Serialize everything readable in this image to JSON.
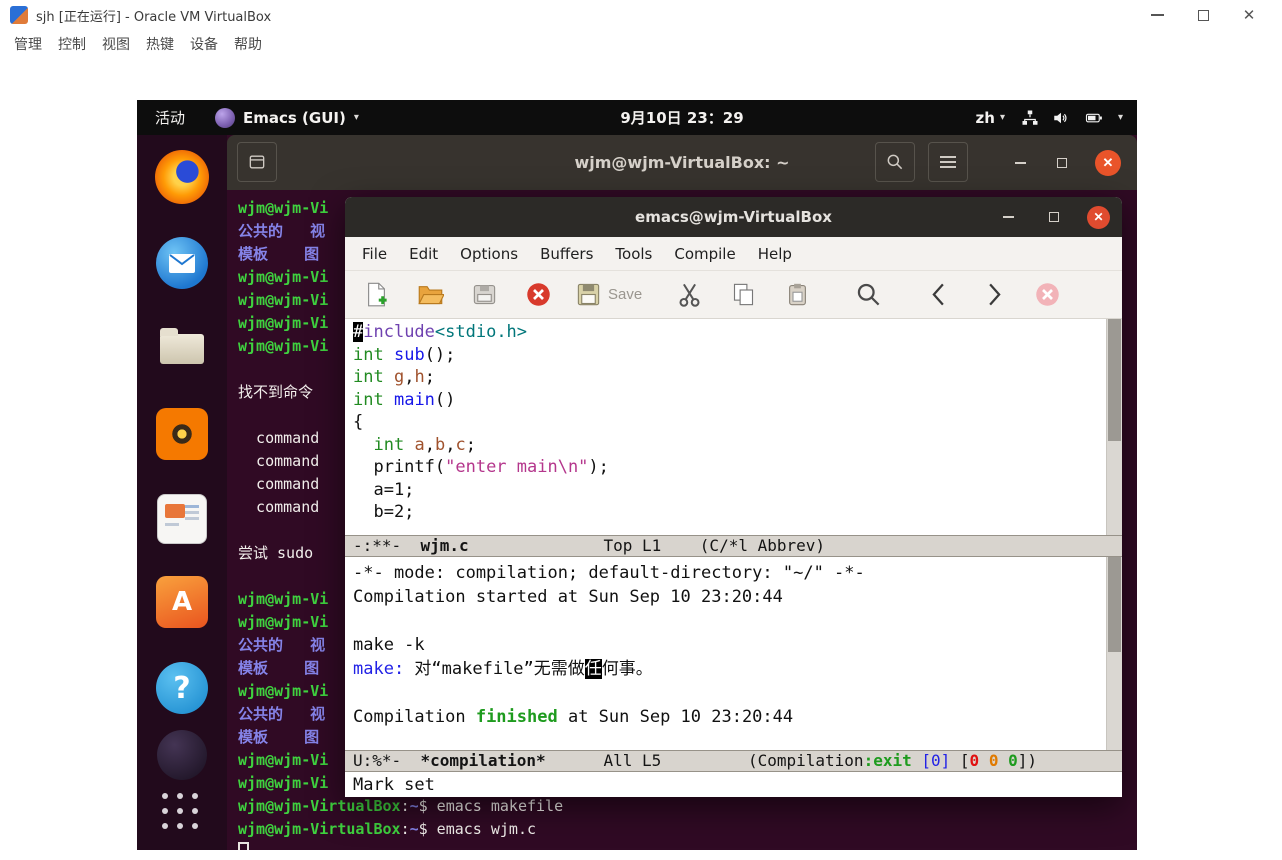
{
  "glyphs": {
    "close_x": "✕",
    "caret_down": "▾",
    "question": "?",
    "software_letter": "A"
  },
  "colors": {
    "desktop_purple": "#2F0A24",
    "terminal_bg": "#300A24",
    "prompt_green": "#3FD23F",
    "directory_blue": "#8583E8",
    "ubuntu_orange": "#E9542A",
    "type_green": "#228B22",
    "function_blue": "#1717E8",
    "variable_sienna": "#A0522D",
    "string_magenta": "#B4368C",
    "success_green": "#1E9B1E",
    "info_blue": "#2222E6"
  },
  "vbox": {
    "title": "sjh [正在运行] - Oracle VM VirtualBox",
    "menu_items": [
      "管理",
      "控制",
      "视图",
      "热键",
      "设备",
      "帮助"
    ]
  },
  "topbar": {
    "activities": "活动",
    "app_name": "Emacs (GUI)",
    "clock": "9月10日 23：29",
    "lang": "zh"
  },
  "dock": {
    "items": [
      "firefox",
      "thunderbird-mail",
      "files",
      "rhythmbox",
      "libreoffice-impress",
      "ubuntu-software",
      "help",
      "background-app",
      "show-applications"
    ]
  },
  "terminal": {
    "title": "wjm@wjm-VirtualBox: ~",
    "lines": [
      [
        {
          "t": "wjm@wjm-Vi",
          "c": "prompt"
        }
      ],
      [
        {
          "t": "公共的   视",
          "c": "dir"
        }
      ],
      [
        {
          "t": "模板    图",
          "c": "dir"
        }
      ],
      [
        {
          "t": "wjm@wjm-Vi",
          "c": "prompt"
        }
      ],
      [
        {
          "t": "wjm@wjm-Vi",
          "c": "prompt"
        }
      ],
      [
        {
          "t": "wjm@wjm-Vi",
          "c": "prompt"
        }
      ],
      [
        {
          "t": "wjm@wjm-Vi",
          "c": "prompt"
        }
      ],
      [],
      [
        {
          "t": "找不到命令"
        }
      ],
      [],
      [
        {
          "t": "  command"
        }
      ],
      [
        {
          "t": "  command"
        }
      ],
      [
        {
          "t": "  command"
        }
      ],
      [
        {
          "t": "  command"
        }
      ],
      [],
      [
        {
          "t": "尝试 sudo"
        }
      ],
      [],
      [
        {
          "t": "wjm@wjm-Vi",
          "c": "prompt"
        }
      ],
      [
        {
          "t": "wjm@wjm-Vi",
          "c": "prompt"
        }
      ],
      [
        {
          "t": "公共的   视",
          "c": "dir"
        }
      ],
      [
        {
          "t": "模板    图",
          "c": "dir"
        }
      ],
      [
        {
          "t": "wjm@wjm-Vi",
          "c": "prompt"
        }
      ],
      [
        {
          "t": "公共的   视",
          "c": "dir"
        }
      ],
      [
        {
          "t": "模板    图",
          "c": "dir"
        }
      ],
      [
        {
          "t": "wjm@wjm-Vi",
          "c": "prompt"
        }
      ],
      [
        {
          "t": "wjm@wjm-Vi",
          "c": "prompt"
        }
      ],
      [
        {
          "t": "wjm@wjm-VirtualBox",
          "c": "prompt"
        },
        {
          "t": ":"
        },
        {
          "t": "~",
          "c": "dir"
        },
        {
          "t": "$ emacs makefile"
        }
      ],
      [
        {
          "t": "wjm@wjm-VirtualBox",
          "c": "prompt"
        },
        {
          "t": ":"
        },
        {
          "t": "~",
          "c": "dir"
        },
        {
          "t": "$ emacs wjm.c"
        }
      ],
      [
        {
          "t": "",
          "c": "hollow"
        }
      ]
    ]
  },
  "emacs": {
    "title": "emacs@wjm-VirtualBox",
    "menu_items": [
      "File",
      "Edit",
      "Options",
      "Buffers",
      "Tools",
      "Compile",
      "Help"
    ],
    "toolbar": {
      "save_label": "Save"
    },
    "code_lines": [
      [
        {
          "t": "#",
          "c": "cursor"
        },
        {
          "t": "include",
          "c": "pp"
        },
        {
          "t": "<stdio.h>",
          "c": "inc"
        }
      ],
      [
        {
          "t": "int",
          "c": "type"
        },
        {
          "t": " "
        },
        {
          "t": "sub",
          "c": "fn"
        },
        {
          "t": "();"
        }
      ],
      [
        {
          "t": "int",
          "c": "type"
        },
        {
          "t": " "
        },
        {
          "t": "g",
          "c": "var"
        },
        {
          "t": ","
        },
        {
          "t": "h",
          "c": "var"
        },
        {
          "t": ";"
        }
      ],
      [
        {
          "t": "int",
          "c": "type"
        },
        {
          "t": " "
        },
        {
          "t": "main",
          "c": "fn"
        },
        {
          "t": "()"
        }
      ],
      [
        {
          "t": "{"
        }
      ],
      [
        {
          "t": "  "
        },
        {
          "t": "int",
          "c": "type"
        },
        {
          "t": " "
        },
        {
          "t": "a",
          "c": "var"
        },
        {
          "t": ","
        },
        {
          "t": "b",
          "c": "var"
        },
        {
          "t": ","
        },
        {
          "t": "c",
          "c": "var"
        },
        {
          "t": ";"
        }
      ],
      [
        {
          "t": "  printf("
        },
        {
          "t": "\"enter main\\n\"",
          "c": "str"
        },
        {
          "t": ");"
        }
      ],
      [
        {
          "t": "  a=1;"
        }
      ],
      [
        {
          "t": "  b=2;"
        }
      ]
    ],
    "modeline_code": [
      [
        {
          "t": "-:**-  "
        },
        {
          "t": "wjm.c",
          "c": "bold"
        },
        {
          "t": "              Top L1    (C/*l Abbrev)"
        }
      ]
    ],
    "compilation_lines": [
      [
        {
          "t": "-*- mode: compilation; default-directory: \"~/\" -*-"
        }
      ],
      [
        {
          "t": "Compilation started at Sun Sep 10 23:20:44"
        }
      ],
      [],
      [
        {
          "t": "make -k"
        }
      ],
      [
        {
          "t": "make:",
          "c": "info"
        },
        {
          "t": " 对“makefile”无需做"
        },
        {
          "t": "任",
          "c": "cursor"
        },
        {
          "t": "何事。"
        }
      ],
      [],
      [
        {
          "t": "Compilation "
        },
        {
          "t": "finished",
          "c": "ok"
        },
        {
          "t": " at Sun Sep 10 23:20:44"
        }
      ]
    ],
    "modeline_compilation": [
      [
        {
          "t": "U:%*-  "
        },
        {
          "t": "*compilation*",
          "c": "bold"
        },
        {
          "t": "      All L5         (Compilation"
        },
        {
          "t": ":exit",
          "c": "ok"
        },
        {
          "t": " "
        },
        {
          "t": "[0]",
          "c": "info"
        },
        {
          "t": " ["
        },
        {
          "t": "0",
          "c": "err"
        },
        {
          "t": " "
        },
        {
          "t": "0",
          "c": "warn"
        },
        {
          "t": " "
        },
        {
          "t": "0",
          "c": "oknb"
        },
        {
          "t": "])"
        }
      ]
    ],
    "minibuffer": "Mark set"
  }
}
